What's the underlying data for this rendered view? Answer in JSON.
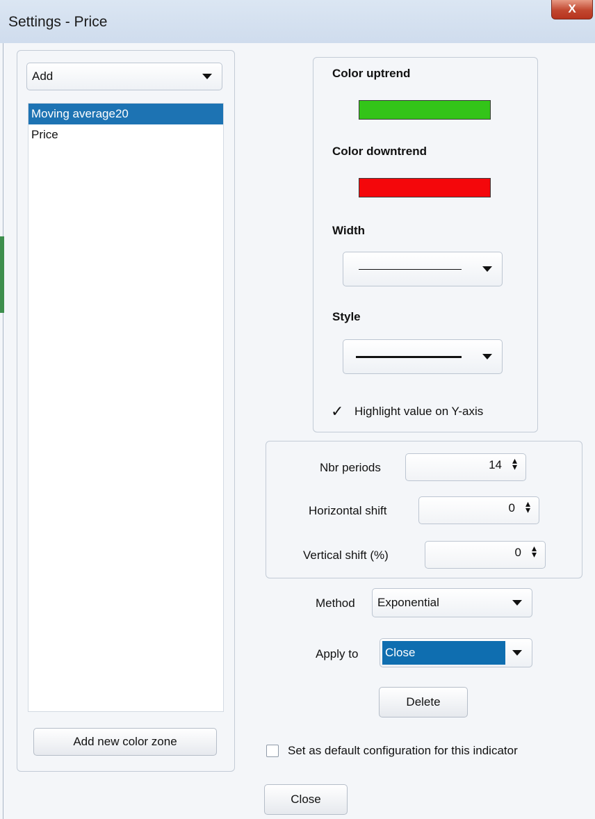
{
  "window": {
    "title": "Settings - Price",
    "close_glyph": "X"
  },
  "left_panel": {
    "add_dropdown": {
      "value": "Add"
    },
    "items": [
      {
        "label": "Moving average20",
        "selected": true
      },
      {
        "label": "Price",
        "selected": false
      }
    ],
    "add_zone_button": "Add new color zone"
  },
  "colors": {
    "uptrend_label": "Color uptrend",
    "uptrend_color": "#33c419",
    "downtrend_label": "Color downtrend",
    "downtrend_color": "#f4070b",
    "width_label": "Width",
    "style_label": "Style",
    "highlight_label": "Highlight value on Y-axis",
    "highlight_checked": true
  },
  "params": {
    "nbr_periods_label": "Nbr periods",
    "nbr_periods_value": "14",
    "horizontal_shift_label": "Horizontal shift",
    "horizontal_shift_value": "0",
    "vertical_shift_label": "Vertical shift (%)",
    "vertical_shift_value": "0"
  },
  "method": {
    "label": "Method",
    "value": "Exponential"
  },
  "apply_to": {
    "label": "Apply to",
    "value": "Close"
  },
  "delete_button": "Delete",
  "default_config": {
    "label": "Set as default configuration for this indicator",
    "checked": false
  },
  "close_button": "Close"
}
